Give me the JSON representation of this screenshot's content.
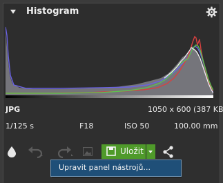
{
  "panel": {
    "title": "Histogram"
  },
  "image_info": {
    "format": "JPG",
    "dimensions": "1050 x 600 (387 KB)",
    "shutter": "1/125 s",
    "aperture": "F18",
    "iso": "ISO 50",
    "focal_length": "100.00 mm"
  },
  "toolbar": {
    "save_label": "Uložit",
    "save_color": "#4f9a2a"
  },
  "context_menu": {
    "item_label": "Upravit panel nástrojů..."
  },
  "icons": [
    "collapse-arrow-icon",
    "gear-icon",
    "drop-icon",
    "undo-icon",
    "redo-icon",
    "image-icon",
    "save-disk-icon",
    "share-icon"
  ]
}
